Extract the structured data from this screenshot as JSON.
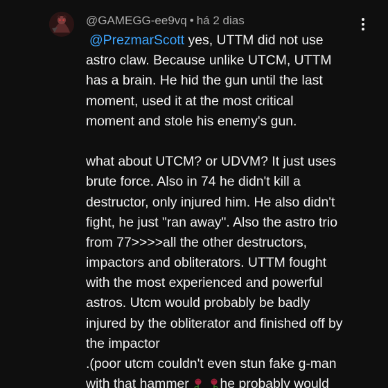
{
  "comment": {
    "author": "@GAMEGG-ee9vq",
    "separator": "•",
    "timestamp": "há 2 dias",
    "menu_icon": "more-vert-icon",
    "avatar_icon": "user-avatar",
    "mention": "@PrezmarScott",
    "lines": {
      "l1_rest": " yes, UTTM did not use",
      "l2": "astro claw. Because unlike UTCM, UTTM",
      "l3": "has a brain. He hid the gun until the last",
      "l4": "moment, used it at the most critical",
      "l5": "moment and stole his enemy's gun.",
      "l6": "what about UTCM? or UDVM? It just uses",
      "l7": "brute force. Also in 74 he didn't kill a",
      "l8": "destructor, only injured him. He also didn't",
      "l9": "fight, he just \"ran away\". Also the astro trio",
      "l10": "from 77>>>>all the other destructors,",
      "l11": "impactors and obliterators. UTTM fought",
      "l12": "with the most experienced and powerful",
      "l13": "astros. Utcm would probably be badly",
      "l14": "injured by the obliterator and finished off by",
      "l15": "the impactor",
      "l16": ".(poor utcm couldn't even stun fake g-man",
      "l17_a": "with that hammer",
      "l17_b": "he probably would"
    },
    "emoji_icons": [
      "wilted-rose-emoji",
      "wilted-rose-emoji"
    ],
    "colors": {
      "background": "#0f0f0f",
      "text": "#f1f1f1",
      "meta": "#aaaaaa",
      "mention": "#3ea6ff"
    }
  }
}
